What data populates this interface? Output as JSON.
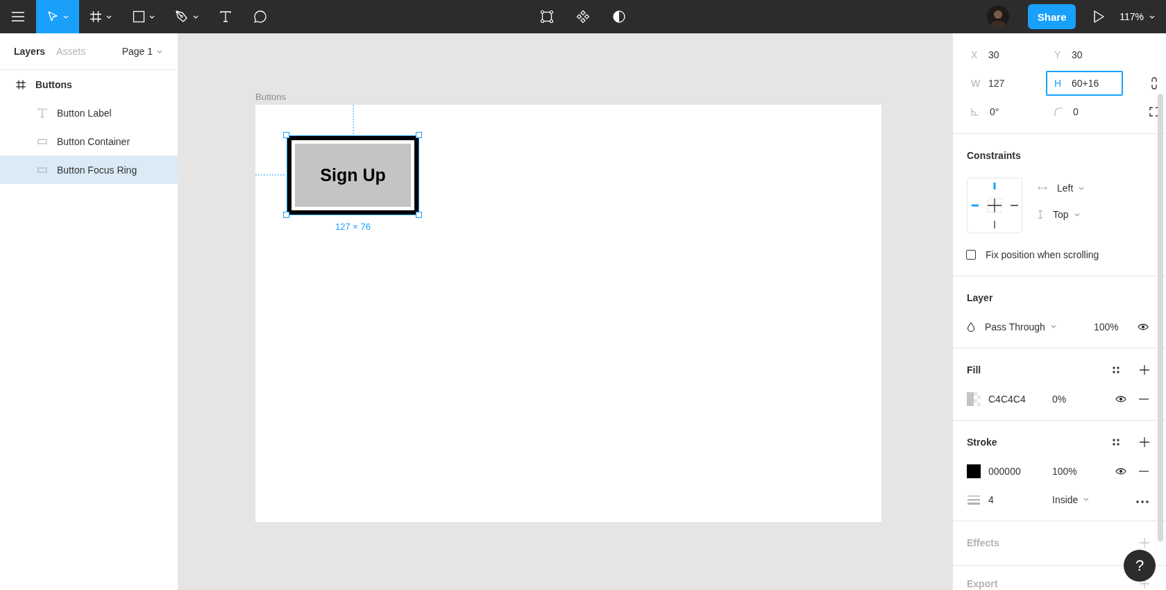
{
  "toolbar": {
    "tools": [
      {
        "kind": "move",
        "selected": true,
        "menu": true
      },
      {
        "kind": "frame",
        "selected": false,
        "menu": true
      },
      {
        "kind": "shape",
        "selected": false,
        "menu": true
      },
      {
        "kind": "pen",
        "selected": false,
        "menu": true
      },
      {
        "kind": "text",
        "selected": false,
        "menu": false
      },
      {
        "kind": "comment",
        "selected": false,
        "menu": false
      }
    ],
    "center_tools": [
      {
        "kind": "vector"
      },
      {
        "kind": "components"
      },
      {
        "kind": "mask"
      }
    ],
    "share": "Share",
    "zoom": "117%"
  },
  "layers_panel": {
    "tabs": [
      {
        "label": "Layers",
        "selected": true
      },
      {
        "label": "Assets",
        "selected": false
      }
    ],
    "page": "Page 1",
    "layers": [
      {
        "label": "Buttons",
        "kind": "frame",
        "selected": false,
        "children": [
          {
            "label": "Button Label",
            "kind": "text",
            "selected": false
          },
          {
            "label": "Button Container",
            "kind": "rectangle",
            "selected": false
          },
          {
            "label": "Button Focus Ring",
            "kind": "rectangle",
            "selected": true
          }
        ]
      }
    ]
  },
  "canvas": {
    "frame_label": "Buttons",
    "button_label": "Sign Up",
    "selection_size": "127 × 76"
  },
  "design_panel": {
    "fields": [
      {
        "kind": "label",
        "label": "X",
        "value": "30",
        "focused": false
      },
      {
        "kind": "label",
        "label": "Y",
        "value": "30",
        "focused": false
      },
      {
        "kind": "label",
        "label": "W",
        "value": "127",
        "focused": false
      },
      {
        "kind": "label",
        "label": "H",
        "value": "60+16",
        "focused": true
      },
      {
        "kind": "angle",
        "value": "0°",
        "focused": false
      },
      {
        "kind": "radius",
        "value": "0",
        "focused": false
      }
    ],
    "constraints": {
      "title": "Constraints",
      "horizontal": "Left",
      "vertical": "Top",
      "fix_label": "Fix position when scrolling",
      "fix_checked": false
    },
    "layer": {
      "title": "Layer",
      "blend": "Pass Through",
      "opacity": "100%",
      "visible": true
    },
    "fill": {
      "title": "Fill",
      "items": [
        {
          "hex": "C4C4C4",
          "opacity": "0%",
          "color": "#c4c4c4",
          "visible": true
        }
      ]
    },
    "stroke": {
      "title": "Stroke",
      "items": [
        {
          "hex": "000000",
          "opacity": "100%",
          "color": "#000000",
          "visible": true
        }
      ],
      "weight": "4",
      "position": "Inside"
    },
    "effects": {
      "title": "Effects",
      "disabled": true
    },
    "export": {
      "title": "Export",
      "disabled": true
    },
    "help": "?"
  }
}
